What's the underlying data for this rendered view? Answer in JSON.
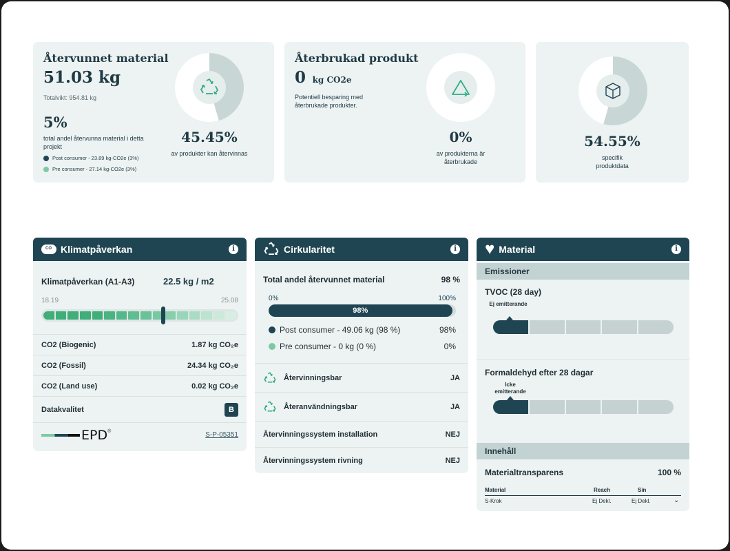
{
  "colors": {
    "dark": "#1f4553",
    "accent_green": "#2fae7e",
    "light_green": "#7ccaa4",
    "card": "#edf2f2"
  },
  "recycled_material": {
    "title": "Återvunnet material",
    "value": "51.03 kg",
    "total_weight": "Totalvikt: 954.81 kg",
    "share": "5%",
    "share_desc": "total andel återvunna material i detta projekt",
    "legend_post": "Post consumer - 23.89 kg-CO2e (3%)",
    "legend_pre": "Pre consumer - 27.14 kg-CO2e (3%)",
    "donut_percent": "45.45%",
    "donut_desc": "av produkter kan återvinnas",
    "donut_fraction": 0.4545,
    "icon": "recycle-icon"
  },
  "reused_product": {
    "title": "Återbrukad produkt",
    "value_num": "0",
    "value_unit": "kg CO2e",
    "desc": "Potentiell besparing med återbrukade produkter.",
    "donut_percent": "0%",
    "donut_desc": "av produkterna är återbrukade",
    "donut_fraction": 0,
    "icon": "triangle-recycle-icon"
  },
  "product_data": {
    "donut_percent": "54.55%",
    "donut_desc": "specifik produktdata",
    "donut_fraction": 0.5455,
    "icon": "cube-icon"
  },
  "climate": {
    "header": "Klimatpåverkan",
    "label": "Klimatpåverkan (A1-A3)",
    "value": "22.5 kg / m2",
    "range_min": "18.19",
    "range_max": "25.08",
    "marker_fraction": 0.62,
    "rows": [
      {
        "label": "CO2 (Biogenic)",
        "value": "1.87 kg CO₂e"
      },
      {
        "label": "CO2 (Fossil)",
        "value": "24.34 kg CO₂e"
      },
      {
        "label": "CO2 (Land use)",
        "value": "0.02 kg CO₂e"
      }
    ],
    "quality_label": "Datakvalitet",
    "quality_badge": "B",
    "epd_logo": "EPD",
    "epd_link": "S-P-05351"
  },
  "circularity": {
    "header": "Cirkularitet",
    "total_label": "Total andel återvunnet material",
    "total_value": "98 %",
    "bar_min": "0%",
    "bar_max": "100%",
    "bar_label": "98%",
    "bar_fraction": 0.98,
    "post_label": "Post consumer - 49.06 kg (98 %)",
    "post_value": "98%",
    "pre_label": "Pre consumer - 0 kg (0 %)",
    "pre_value": "0%",
    "recyclable_label": "Återvinningsbar",
    "recyclable_value": "JA",
    "reusable_label": "Återanvändningsbar",
    "reusable_value": "JA",
    "install_label": "Återvinningssystem installation",
    "install_value": "NEJ",
    "demolition_label": "Återvinningssystem rivning",
    "demolition_value": "NEJ"
  },
  "material": {
    "header": "Material",
    "emissions_head": "Emissioner",
    "tvoc_label": "TVOC (28 day)",
    "tvoc_marker": "Ej emitterande",
    "formaldehyde_label": "Formaldehyd efter 28 dagar",
    "formaldehyde_marker": "Icke emitterande",
    "content_head": "Innehåll",
    "transparency_label": "Materialtransparens",
    "transparency_value": "100 %",
    "table_headers": [
      "Material",
      "Reach",
      "Sin"
    ],
    "table_rows": [
      [
        "S-Krok",
        "Ej Dekl.",
        "Ej Dekl."
      ]
    ]
  }
}
